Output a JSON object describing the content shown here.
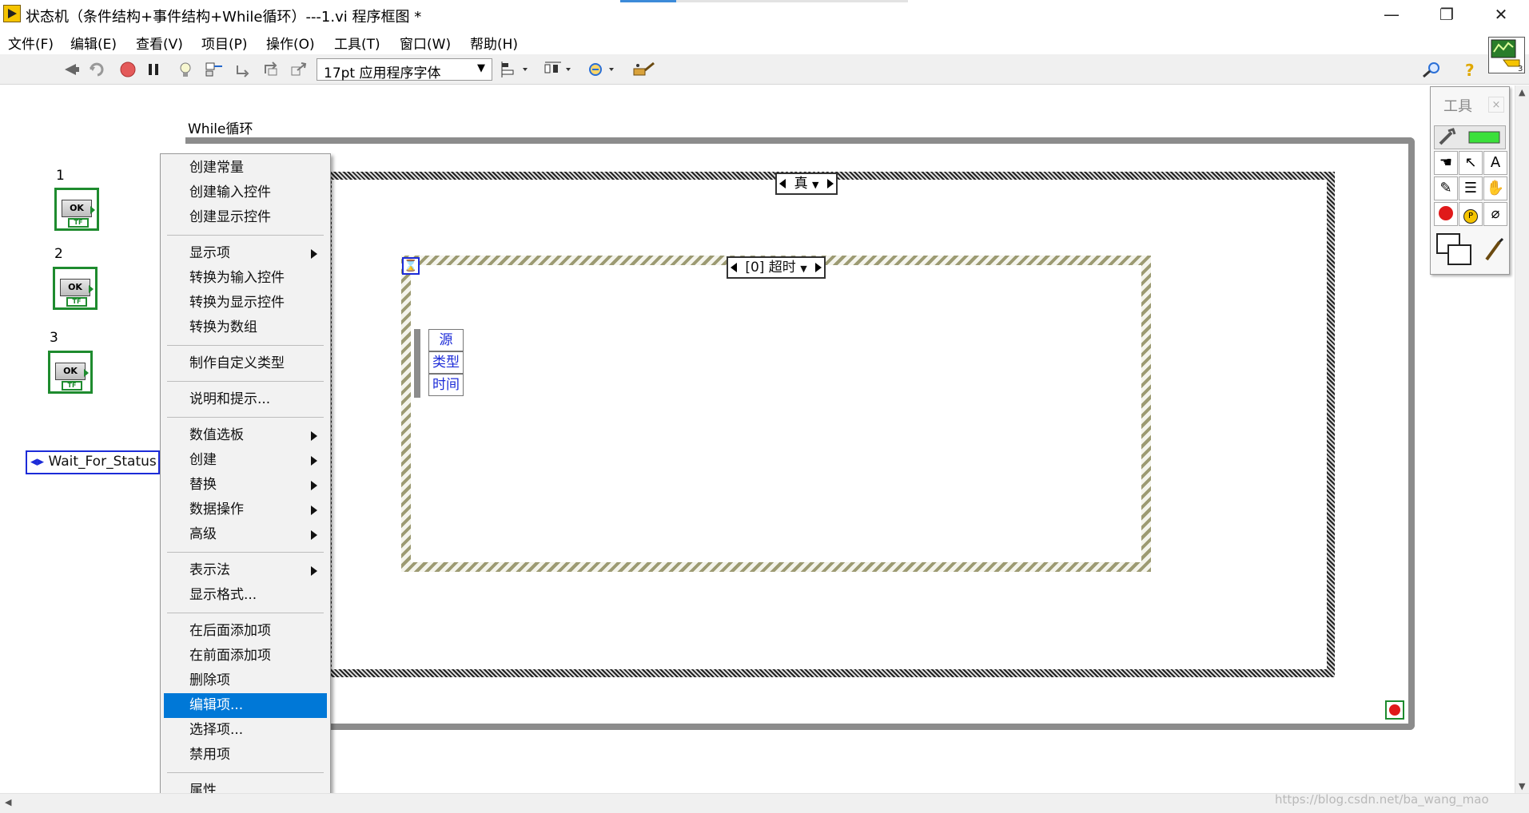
{
  "window": {
    "title": "状态机（条件结构+事件结构+While循环）---1.vi 程序框图 *",
    "minimize_label": "—",
    "maximize_label": "❐",
    "close_label": "✕"
  },
  "menu": {
    "items": [
      "文件(F)",
      "编辑(E)",
      "查看(V)",
      "项目(P)",
      "操作(O)",
      "工具(T)",
      "窗口(W)",
      "帮助(H)"
    ]
  },
  "toolbar": {
    "font": "17pt 应用程序字体",
    "icons": [
      "run-arrow-icon",
      "run-continuously-icon",
      "abort-icon",
      "pause-icon",
      "highlight-execution-icon",
      "retain-wire-values-icon",
      "step-into-icon",
      "step-over-icon",
      "step-out-icon",
      "align-objects-icon",
      "distribute-objects-icon",
      "reorder-icon",
      "cleanup-diagram-icon",
      "search-icon",
      "help-icon",
      "vi-icon"
    ]
  },
  "diagram": {
    "while_loop_label": "While循环",
    "controls": [
      {
        "label": "1",
        "ok": "OK",
        "tf": "TF"
      },
      {
        "label": "2",
        "ok": "OK",
        "tf": "TF"
      },
      {
        "label": "3",
        "ok": "OK",
        "tf": "TF"
      }
    ],
    "enum_value": "Wait_For_Status",
    "case_selector": "真",
    "event_selector": "[0] 超时",
    "timeout_terminal": "⌛",
    "event_fields": [
      "源",
      "类型",
      "时间"
    ]
  },
  "context_menu": {
    "groups": [
      [
        {
          "label": "创建常量"
        },
        {
          "label": "创建输入控件"
        },
        {
          "label": "创建显示控件"
        }
      ],
      [
        {
          "label": "显示项",
          "sub": true
        },
        {
          "label": "转换为输入控件"
        },
        {
          "label": "转换为显示控件"
        },
        {
          "label": "转换为数组"
        }
      ],
      [
        {
          "label": "制作自定义类型"
        }
      ],
      [
        {
          "label": "说明和提示..."
        }
      ],
      [
        {
          "label": "数值选板",
          "sub": true
        },
        {
          "label": "创建",
          "sub": true
        },
        {
          "label": "替换",
          "sub": true
        },
        {
          "label": "数据操作",
          "sub": true
        },
        {
          "label": "高级",
          "sub": true
        }
      ],
      [
        {
          "label": "表示法",
          "sub": true
        },
        {
          "label": "显示格式..."
        }
      ],
      [
        {
          "label": "在后面添加项"
        },
        {
          "label": "在前面添加项"
        },
        {
          "label": "删除项"
        },
        {
          "label": "编辑项...",
          "selected": true
        },
        {
          "label": "选择项..."
        },
        {
          "label": "禁用项"
        }
      ],
      [
        {
          "label": "属性"
        }
      ]
    ]
  },
  "tools_palette": {
    "title": "工具",
    "close": "×",
    "tools": [
      "automatic-tool-selection-icon",
      "operate-value-icon",
      "position-select-icon",
      "edit-text-icon",
      "connect-wire-icon",
      "object-shortcut-menu-icon",
      "scroll-window-icon",
      "breakpoint-icon",
      "probe-icon",
      "get-color-icon",
      "set-color-icon"
    ]
  },
  "watermark": "https://blog.csdn.net/ba_wang_mao",
  "colors": {
    "accent": "#0078d7",
    "bool_green": "#1e8b2e",
    "enum_blue": "#1c2bd8",
    "loop_gray": "#8c8c8c"
  }
}
